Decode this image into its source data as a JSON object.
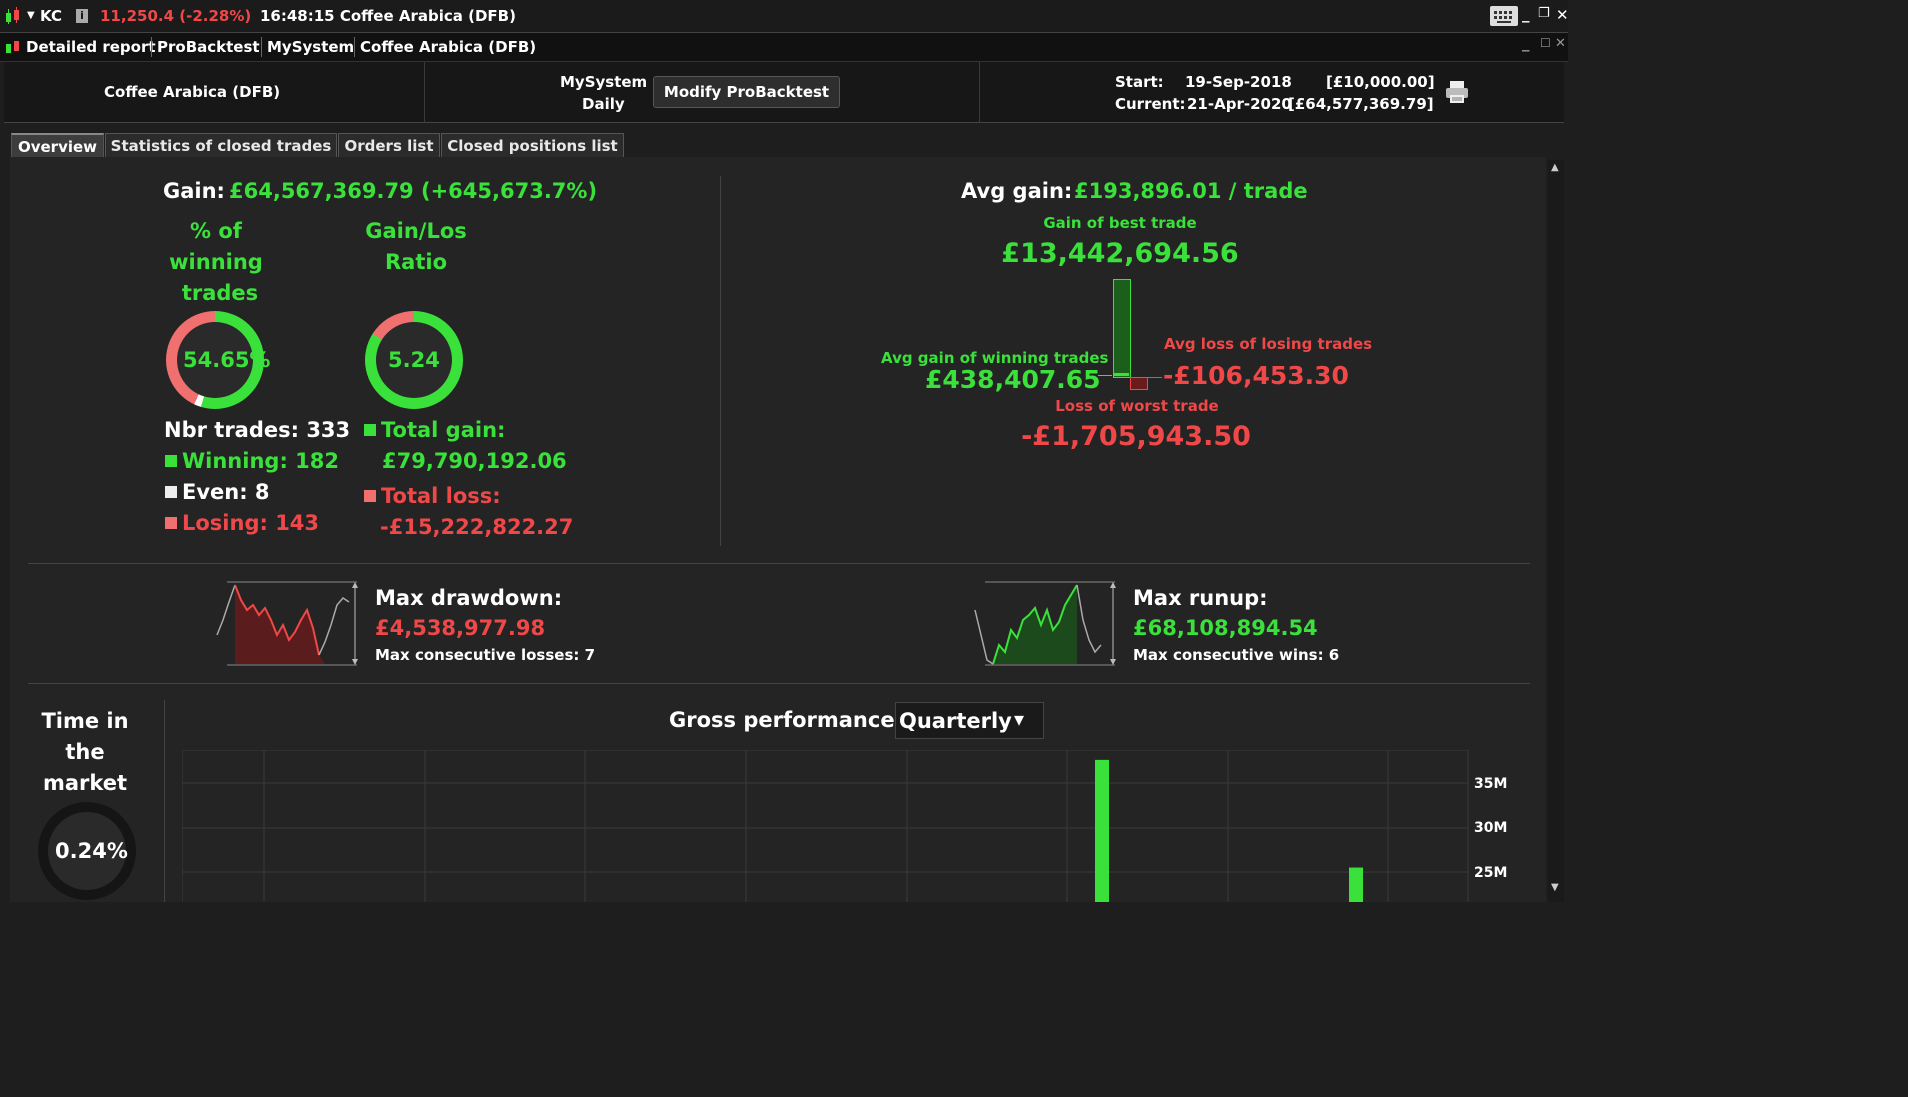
{
  "titlebar": {
    "symbol": "KC",
    "price": "11,250.4 (-2.28%)",
    "time_instrument": "16:48:15 Coffee Arabica (DFB)"
  },
  "menubar": {
    "items": [
      "Detailed report",
      "ProBacktest",
      "MySystem",
      "Coffee Arabica (DFB)"
    ]
  },
  "header": {
    "instrument": "Coffee Arabica (DFB)",
    "system_name": "MySystem",
    "system_period": "Daily",
    "modify_button": "Modify ProBacktest",
    "start_label": "Start:",
    "start_date": "19-Sep-2018",
    "start_value": "[£10,000.00]",
    "current_label": "Current:",
    "current_date": "21-Apr-2020",
    "current_value": "[£64,577,369.79]"
  },
  "tabs": [
    "Overview",
    "Statistics of closed trades",
    "Orders list",
    "Closed positions list"
  ],
  "overview": {
    "gain_label": "Gain:",
    "gain_value": "£64,567,369.79 (+645,673.7%)",
    "winning_pct_title_1": "% of",
    "winning_pct_title_2": "winning",
    "winning_pct_title_3": "trades",
    "winning_pct_value": "54.65%",
    "winning_pct": 54.65,
    "ratio_title_1": "Gain/Los",
    "ratio_title_2": "Ratio",
    "ratio_value": "5.24",
    "nbr_trades": "Nbr trades: 333",
    "winning": "Winning: 182",
    "even": "Even: 8",
    "losing": "Losing: 143",
    "total_gain_label": "Total gain:",
    "total_gain_value": "£79,790,192.06",
    "total_loss_label": "Total loss:",
    "total_loss_value": "-£15,222,822.27",
    "avg_gain_label": "Avg gain:",
    "avg_gain_value": "£193,896.01 / trade",
    "best_trade_label": "Gain of best trade",
    "best_trade_value": "£13,442,694.56",
    "avg_win_label": "Avg gain of winning trades",
    "avg_win_value": "£438,407.65",
    "avg_loss_label": "Avg loss of losing trades",
    "avg_loss_value": "-£106,453.30",
    "worst_trade_label": "Loss of worst trade",
    "worst_trade_value": "-£1,705,943.50",
    "max_drawdown_label": "Max drawdown:",
    "max_drawdown_value": "£4,538,977.98",
    "max_cons_losses": "Max consecutive losses: 7",
    "max_runup_label": "Max runup:",
    "max_runup_value": "£68,108,894.54",
    "max_cons_wins": "Max consecutive wins: 6",
    "time_market_1": "Time in",
    "time_market_2": "the",
    "time_market_3": "market",
    "time_market_value": "0.24%",
    "gross_perf_label": "Gross performance",
    "gross_perf_period": "Quarterly"
  },
  "chart_data": {
    "type": "bar",
    "ytick_labels": [
      "35M",
      "30M",
      "25M"
    ],
    "series": [
      {
        "values": [
          null,
          null,
          null,
          null,
          null,
          null,
          37.6,
          null,
          25.5
        ]
      }
    ]
  },
  "colors": {
    "gain": "#3be13b",
    "loss": "#f04848",
    "background": "#242424"
  }
}
